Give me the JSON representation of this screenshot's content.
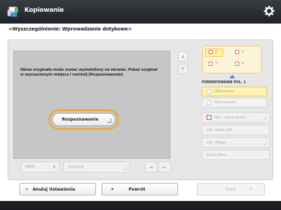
{
  "titlebar": {
    "title": "Kopiowanie"
  },
  "breadcrumb": "<Wyszczególnienie: Wprowadzanie dotykowe>",
  "preview": {
    "message": "Obraz oryginału może zostać wyświetlony na ekranie. Pokaż oryginał w wyznaczonym miejscu i naciśnij [Rozpoznawanie].",
    "recognize_button": "Rozpoznawanie"
  },
  "controls": {
    "zoom": "100%",
    "fit": "Dopasuj",
    "prev": "◄",
    "next": "►"
  },
  "page_grid": {
    "cells": [
      "1",
      "2",
      "3",
      "4"
    ]
  },
  "format": {
    "label": "FORMATOWANIE POL. 1",
    "options": [
      "Obracanie",
      "Wyrzucanie"
    ]
  },
  "side": {
    "items": [
      "Wyc. wielu punk.",
      "Usr. wielu pkt.",
      "Ust. Regul.",
      "Kasuj Pom."
    ]
  },
  "bottom": {
    "cancel": "Anuluj Ustawienia",
    "back": "Powrót",
    "next": "Dalej"
  }
}
